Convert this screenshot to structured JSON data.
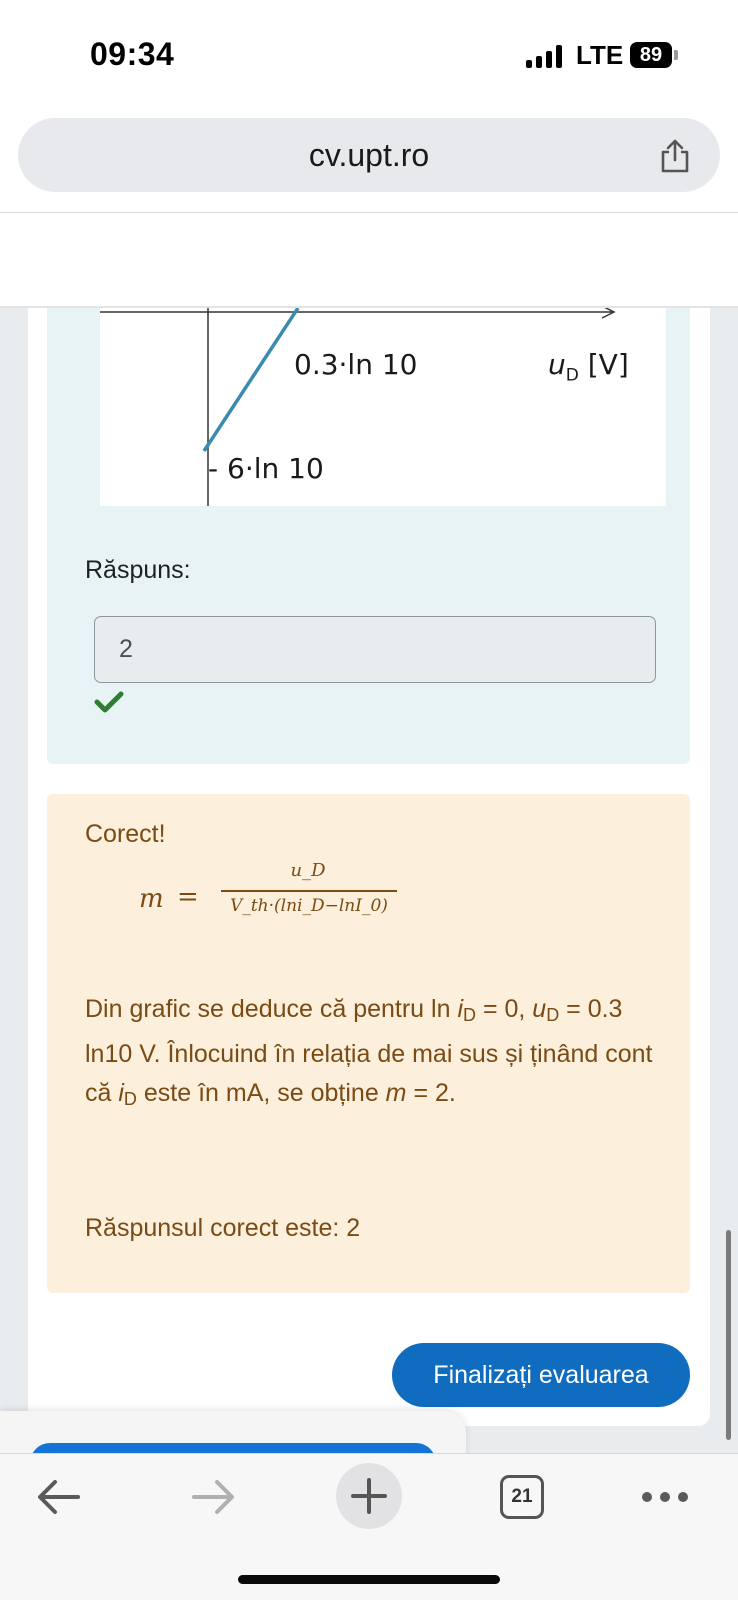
{
  "status_bar": {
    "time": "09:34",
    "network": "LTE",
    "battery": "89"
  },
  "browser": {
    "url": "cv.upt.ro",
    "tab_count": "21"
  },
  "question": {
    "graph": {
      "label_intercept_x": "0.3·ln 10",
      "label_intercept_y": "- 6·ln 10",
      "label_x_axis_var": "u",
      "label_x_axis_sub": "D",
      "label_x_axis_unit": " [V]"
    },
    "answer_label": "Răspuns:",
    "answer_value": "2",
    "answer_status": "correct",
    "answer_status_icon": "checkmark-icon"
  },
  "feedback": {
    "verdict": "Corect!",
    "formula": {
      "lhs": "m",
      "eq": "=",
      "numerator": "u_D",
      "denominator": "V_th·(lni_D−lnI_0)"
    },
    "explanation": {
      "p1": "Din grafic se deduce că pentru ln ",
      "i": "i",
      "sub_d": "D",
      "p2": " = 0, ",
      "u": "u",
      "p3": " = 0.3 ln10 V. Înlocuind în relația de mai sus și ținând cont că ",
      "p4": " este în mA, se obține ",
      "m": "m",
      "p5": " = 2."
    },
    "correct_answer": "Răspunsul corect este: 2"
  },
  "actions": {
    "finish_label": "Finalizați evaluarea"
  },
  "colors": {
    "accent": "#0f6cbf",
    "question_bg": "#e7f3f5",
    "feedback_bg": "#fcefdc",
    "feedback_text": "#7a4b14",
    "correct_green": "#2e7d32",
    "graph_line": "#3a8bb0"
  }
}
